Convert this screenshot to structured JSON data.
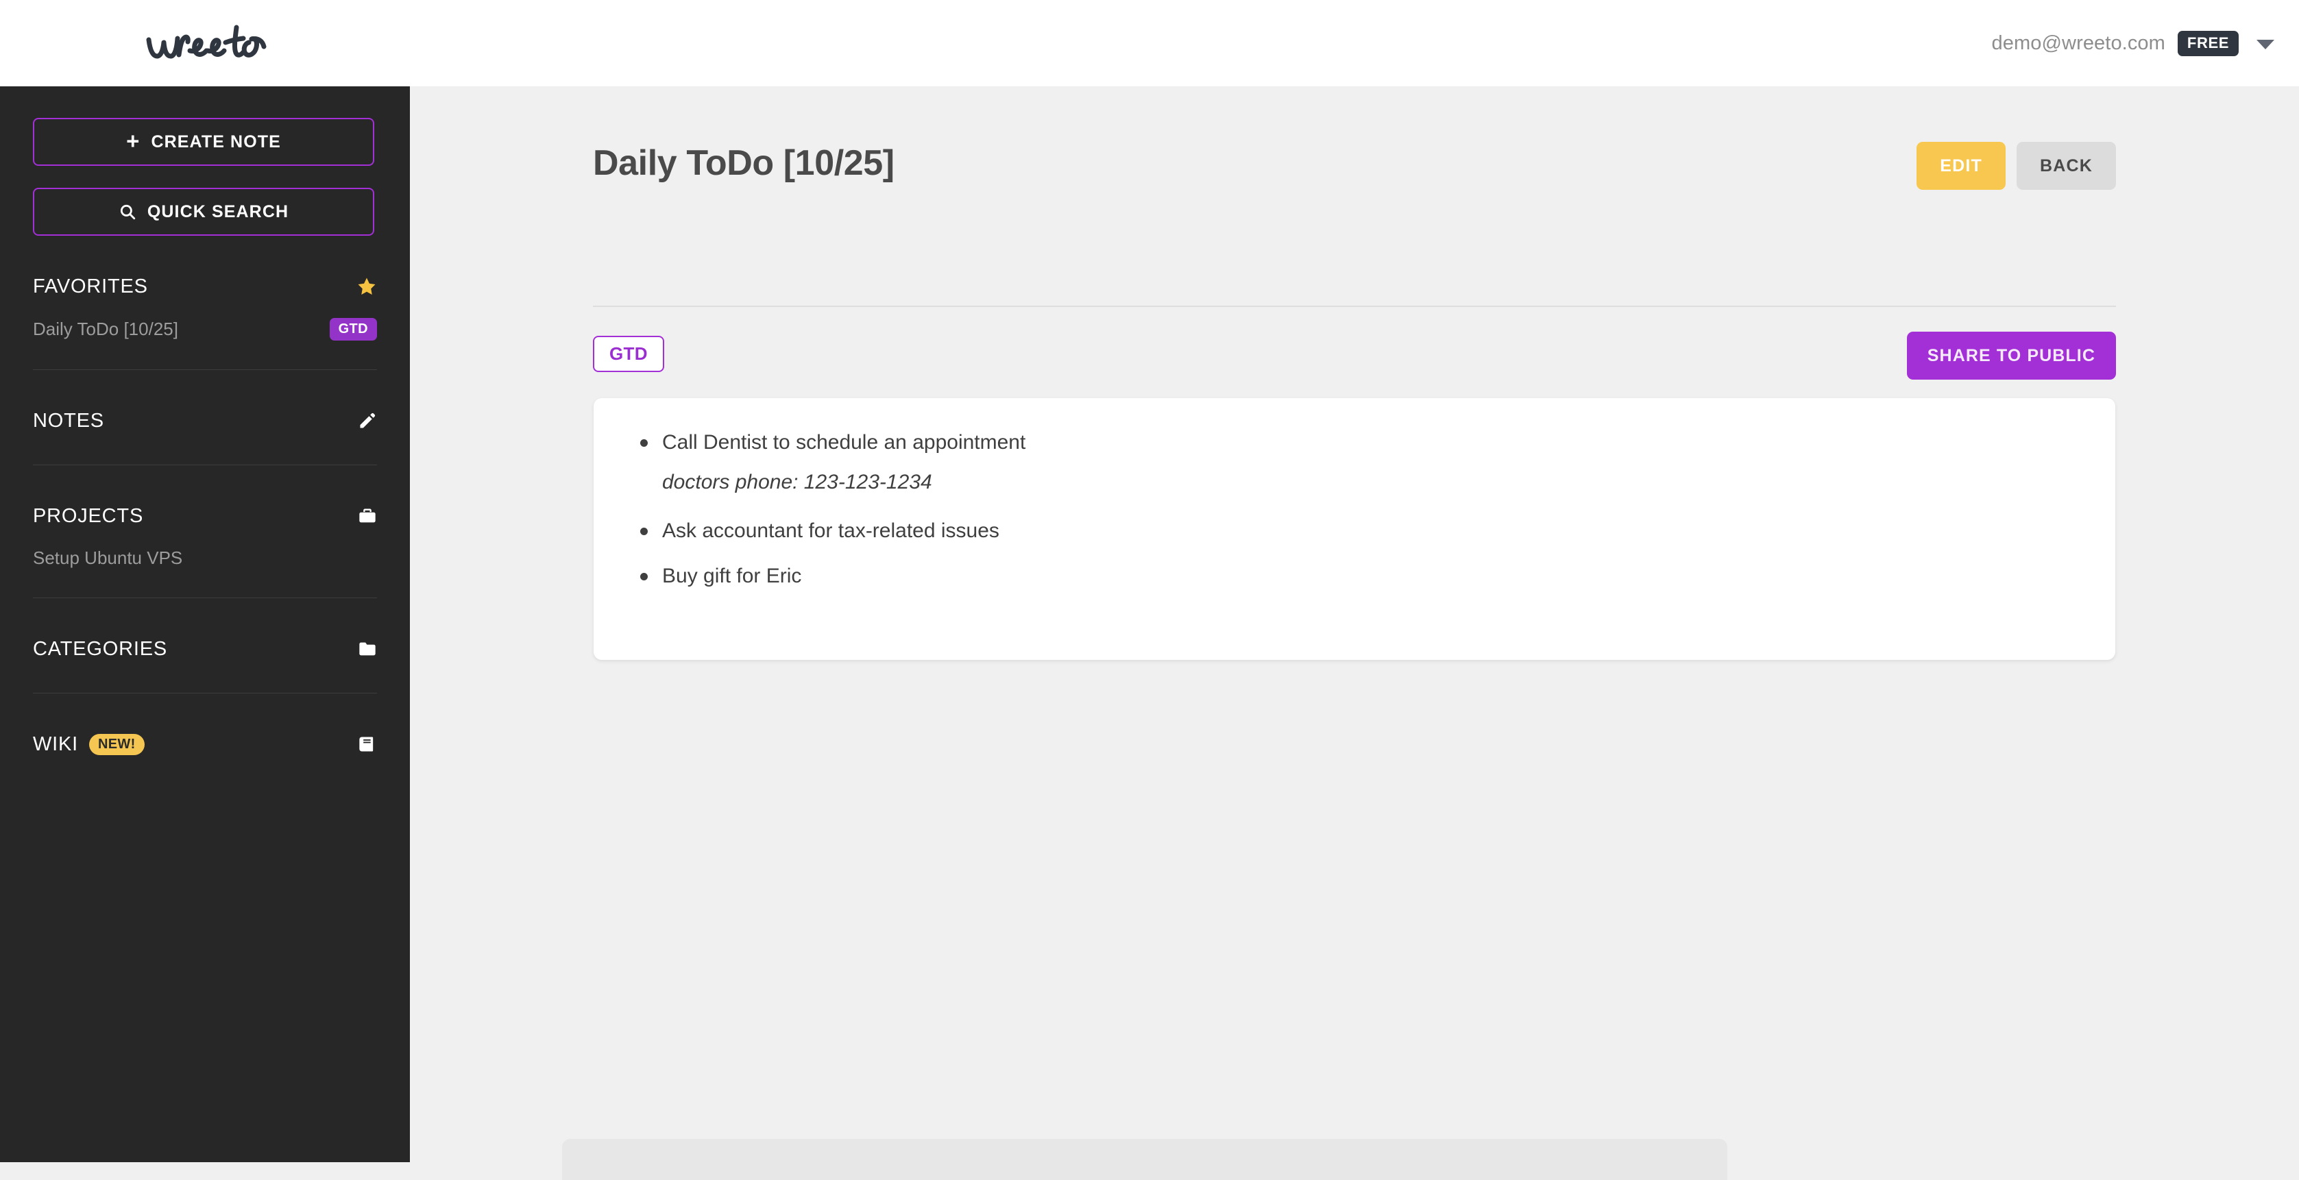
{
  "app": {
    "logo_text": "wreeto",
    "accent_purple": "#a32fd6",
    "badge_purple": "#9333c8",
    "accent_yellow": "#f7c74f",
    "sidebar_bg": "#272727",
    "page_bg": "#f0f0f0"
  },
  "topbar": {
    "email": "demo@wreeto.com",
    "plan": "FREE",
    "caret_icon": "chevron-down-icon"
  },
  "sidebar": {
    "create_note_label": "CREATE NOTE",
    "create_note_icon": "plus-icon",
    "quick_search_label": "QUICK SEARCH",
    "quick_search_icon": "search-icon",
    "sections": [
      {
        "title": "FAVORITES",
        "icon": "star-icon",
        "items": [
          {
            "label": "Daily ToDo [10/25]",
            "badge": "GTD"
          }
        ]
      },
      {
        "title": "NOTES",
        "icon": "pencil-icon",
        "items": []
      },
      {
        "title": "PROJECTS",
        "icon": "briefcase-icon",
        "items": [
          {
            "label": "Setup Ubuntu VPS",
            "badge": ""
          }
        ]
      },
      {
        "title": "CATEGORIES",
        "icon": "folder-icon",
        "items": []
      },
      {
        "title": "WIKI",
        "icon": "book-icon",
        "badge": "NEW!",
        "items": []
      }
    ]
  },
  "main": {
    "page_title": "Daily ToDo [10/25]",
    "edit_label": "EDIT",
    "back_label": "BACK",
    "tag_label": "GTD",
    "share_label": "SHARE TO PUBLIC",
    "note_items": [
      "Call Dentist to schedule an appointment",
      "Ask accountant for tax-related issues",
      "Buy gift for Eric"
    ],
    "note_subline": "doctors phone: 123-123-1234"
  }
}
